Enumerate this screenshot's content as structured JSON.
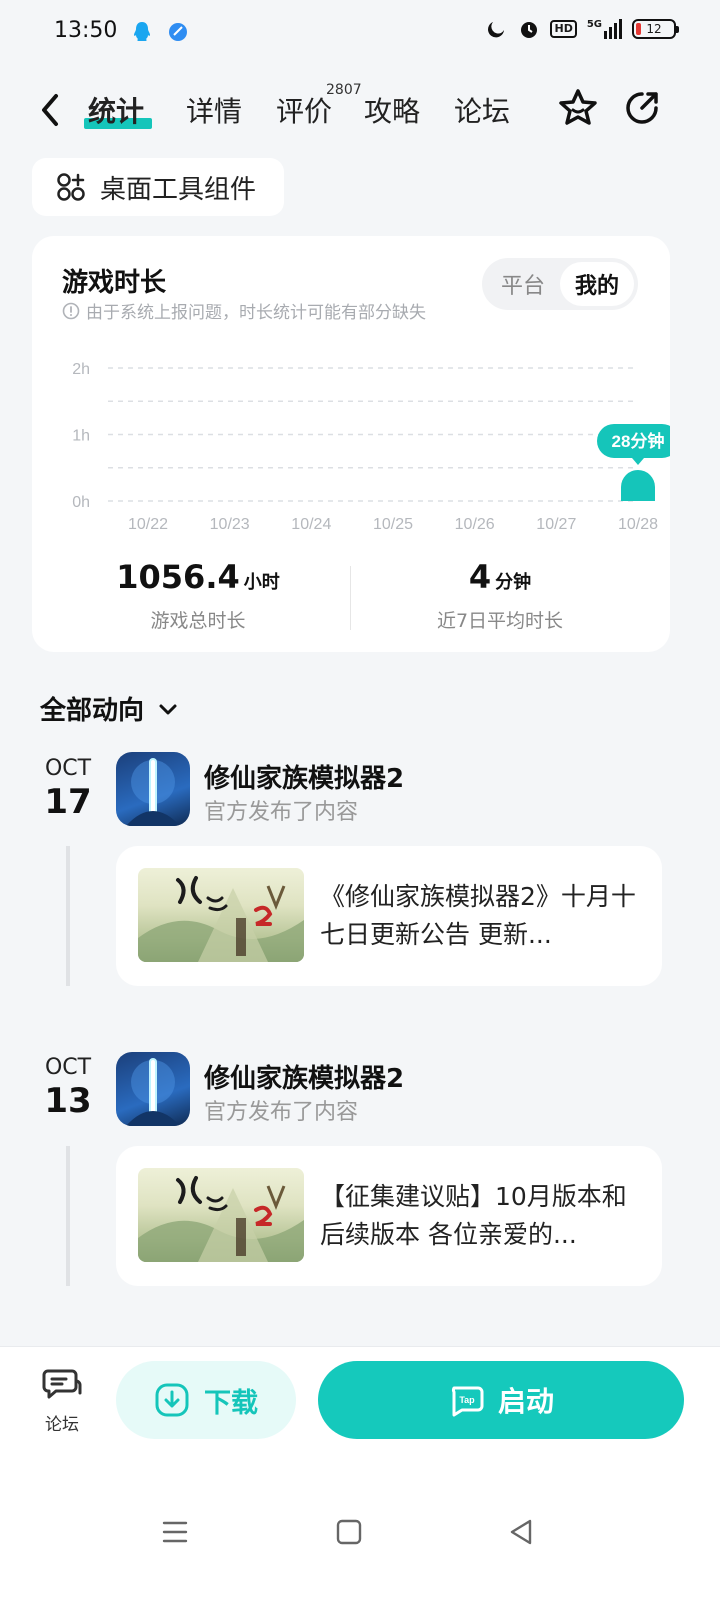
{
  "status_bar": {
    "time": "13:50",
    "hd_label": "HD",
    "network_label": "5G",
    "battery": "12"
  },
  "nav": {
    "tabs": [
      "统计",
      "详情",
      "评价",
      "攻略",
      "论坛"
    ],
    "review_count": "2807"
  },
  "widget_button": {
    "label": "桌面工具组件"
  },
  "stats": {
    "title": "游戏时长",
    "note": "由于系统上报问题，时长统计可能有部分缺失",
    "toggle": {
      "platform": "平台",
      "mine": "我的",
      "selected": "我的"
    },
    "total_value": "1056.4",
    "total_unit": "小时",
    "total_label": "游戏总时长",
    "avg_value": "4",
    "avg_unit": "分钟",
    "avg_label": "近7日平均时长"
  },
  "chart_data": {
    "type": "bar",
    "categories": [
      "10/22",
      "10/23",
      "10/24",
      "10/25",
      "10/26",
      "10/27",
      "10/28"
    ],
    "values_minutes": [
      0,
      0,
      0,
      0,
      0,
      0,
      28
    ],
    "y_ticks": [
      "0h",
      "1h",
      "2h"
    ],
    "ylim_hours": [
      0,
      2
    ],
    "grid": true,
    "callout": "28分钟",
    "bar_color": "#15c5ba"
  },
  "feed": {
    "filter_label": "全部动向",
    "items": [
      {
        "month": "OCT",
        "day": "17",
        "app_name": "修仙家族模拟器2",
        "action": "官方发布了内容",
        "post_text": "《修仙家族模拟器2》十月十七日更新公告 更新..."
      },
      {
        "month": "OCT",
        "day": "13",
        "app_name": "修仙家族模拟器2",
        "action": "官方发布了内容",
        "post_text": "【征集建议贴】10月版本和后续版本 各位亲爱的..."
      }
    ]
  },
  "bottom_bar": {
    "forum_label": "论坛",
    "download_label": "下载",
    "launch_label": "启动",
    "accent": "#15c9bc"
  }
}
